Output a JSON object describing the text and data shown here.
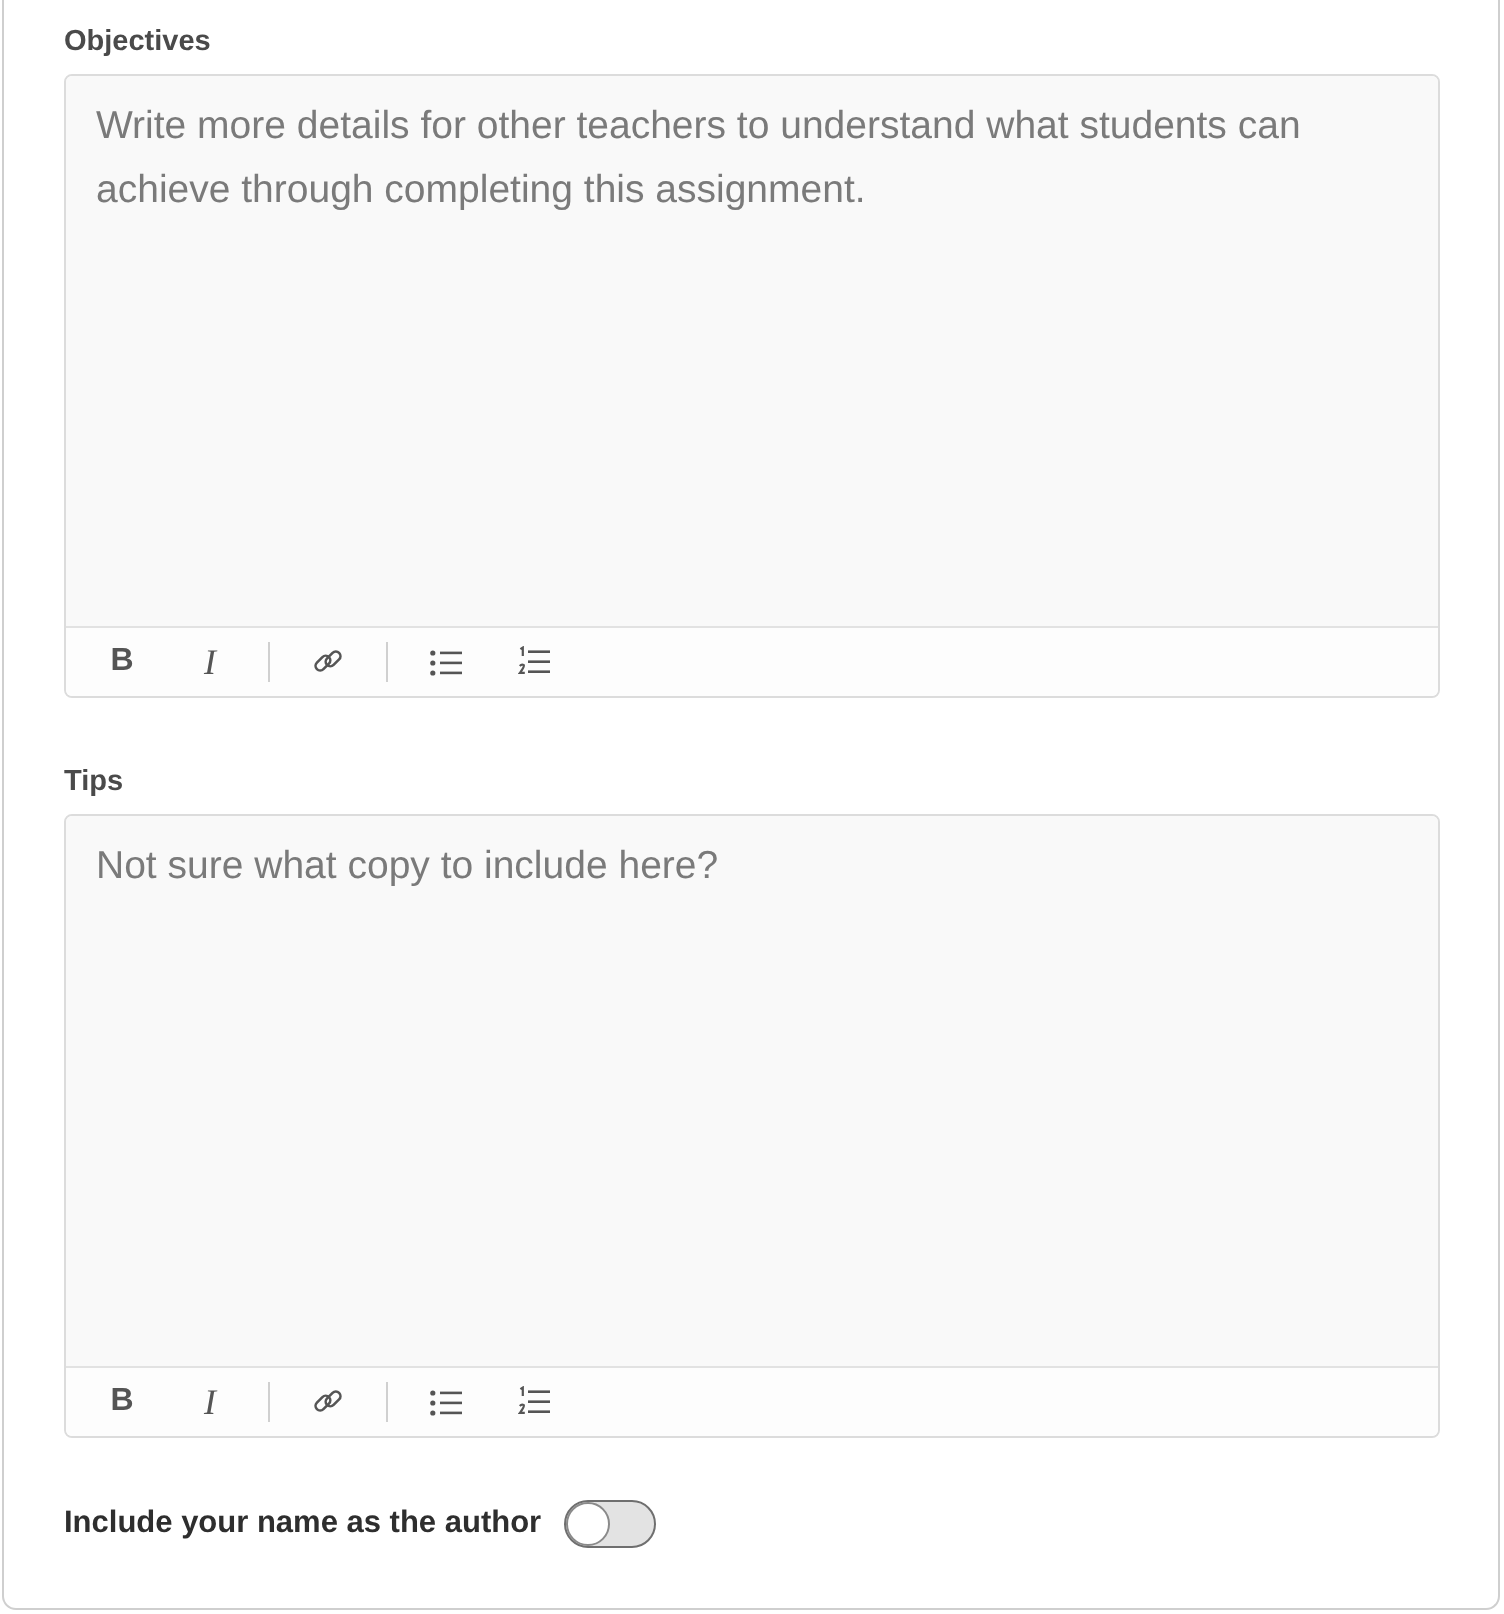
{
  "fields": [
    {
      "label": "Objectives",
      "placeholder": "Write more details for other teachers to understand what students can achieve through completing this assignment.",
      "toolbar": [
        {
          "kind": "bold",
          "text": "B"
        },
        {
          "kind": "italic",
          "text": "I"
        },
        {
          "kind": "separator"
        },
        {
          "kind": "link"
        },
        {
          "kind": "separator"
        },
        {
          "kind": "bullet_list"
        },
        {
          "kind": "numbered_list"
        }
      ]
    },
    {
      "label": "Tips",
      "placeholder": "Not sure what copy to include here?",
      "toolbar": [
        {
          "kind": "bold",
          "text": "B"
        },
        {
          "kind": "italic",
          "text": "I"
        },
        {
          "kind": "separator"
        },
        {
          "kind": "link"
        },
        {
          "kind": "separator"
        },
        {
          "kind": "bullet_list"
        },
        {
          "kind": "numbered_list"
        }
      ]
    }
  ],
  "author_toggle": {
    "label": "Include your name as the author",
    "on": false
  }
}
